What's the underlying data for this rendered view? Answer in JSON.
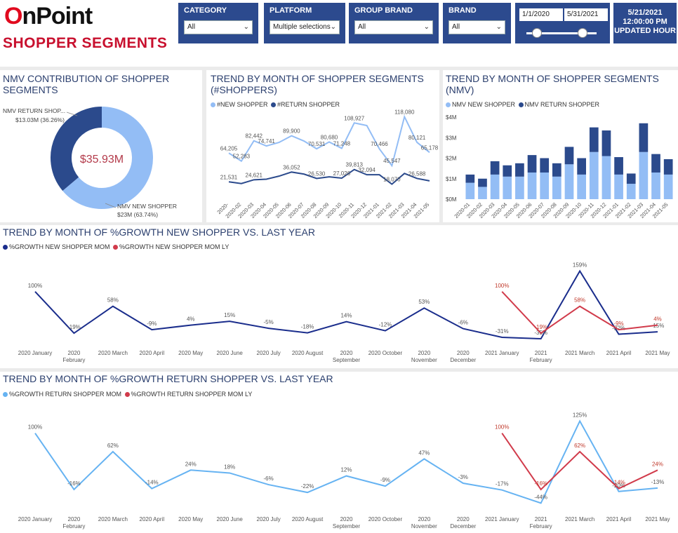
{
  "header": {
    "logo_mark": "O",
    "logo_rest": "nPoint",
    "title": "SHOPPER SEGMENTS"
  },
  "filters": [
    {
      "label": "CATEGORY",
      "value": "All"
    },
    {
      "label": "PLATFORM",
      "value": "Multiple selections"
    },
    {
      "label": "GROUP BRAND",
      "value": "All"
    },
    {
      "label": "BRAND",
      "value": "All"
    }
  ],
  "date_range": {
    "start": "1/1/2020",
    "end": "5/31/2021",
    "slider_start": 0.15,
    "slider_end": 0.8
  },
  "updated": {
    "date": "5/21/2021",
    "time": "12:00:00 PM",
    "label": "UPDATED HOUR"
  },
  "colors": {
    "dark_blue": "#2b4a8c",
    "light_blue": "#93bdf5",
    "navy": "#1a2d8c",
    "sky": "#66b3f2",
    "red": "#d13b4b",
    "title": "#2b3f6e"
  },
  "months_short": [
    "2020-01",
    "2020-02",
    "2020-03",
    "2020-04",
    "2020-05",
    "2020-06",
    "2020-07",
    "2020-08",
    "2020-09",
    "2020-10",
    "2020-11",
    "2020-12",
    "2021-01",
    "2021-02",
    "2021-03",
    "2021-04",
    "2021-05"
  ],
  "months_long": [
    "2020 January",
    "2020 February",
    "2020 March",
    "2020 April",
    "2020 May",
    "2020 June",
    "2020 July",
    "2020 August",
    "2020 September",
    "2020 October",
    "2020 November",
    "2020 December",
    "2021 January",
    "2021 February",
    "2021 March",
    "2021 April",
    "2021 May"
  ],
  "chart_data": [
    {
      "type": "pie",
      "title": "NMV CONTRIBUTION OF SHOPPER SEGMENTS",
      "center_label": "$35.93M",
      "slices": [
        {
          "name": "NMV RETURN SHOP...",
          "label": "$13.03M (36.26%)",
          "value": 13.03,
          "pct": 36.26
        },
        {
          "name": "NMV NEW SHOPPER",
          "label": "$23M (63.74%)",
          "value": 23,
          "pct": 63.74
        }
      ]
    },
    {
      "type": "line",
      "title": "TREND BY MONTH OF SHOPPER SEGMENTS (#SHOPPERS)",
      "x": [
        "2020-",
        "2020-02",
        "2020-03",
        "2020-04",
        "2020-05",
        "2020-06",
        "2020-07",
        "2020-08",
        "2020-09",
        "2020-10",
        "2020-11",
        "2020-12",
        "2021-01",
        "2021-02",
        "2021-03",
        "2021-04",
        "2021-05"
      ],
      "series": [
        {
          "name": "#NEW SHOPPER",
          "values": [
            64205,
            52283,
            82442,
            74741,
            80000,
            89900,
            82000,
            70531,
            80680,
            71248,
            108927,
            105000,
            70466,
            45547,
            118080,
            80121,
            65178
          ],
          "labels": [
            "64,205",
            "52,283",
            "82,442",
            "74,741",
            "",
            "89,900",
            "",
            "70,531",
            "80,680",
            "71,248",
            "108,927",
            "",
            "70,466",
            "45,547",
            "118,080",
            "80,121",
            "65,178"
          ]
        },
        {
          "name": "#RETURN SHOPPER",
          "values": [
            21531,
            19000,
            24621,
            25500,
            30000,
            36052,
            33000,
            26530,
            29000,
            27026,
            39813,
            32094,
            32094,
            18070,
            34000,
            26588,
            23000
          ],
          "labels": [
            "21,531",
            "",
            "24,621",
            "",
            "",
            "36,052",
            "",
            "26,530",
            "",
            "27,026",
            "39,813",
            "32,094",
            "",
            "18,070",
            "",
            "26,588",
            ""
          ]
        }
      ],
      "ylim": [
        0,
        130000
      ]
    },
    {
      "type": "bar",
      "title": "TREND BY MONTH OF SHOPPER SEGMENTS (NMV)",
      "categories": [
        "2020-01",
        "2020-02",
        "2020-03",
        "2020-04",
        "2020-05",
        "2020-06",
        "2020-07",
        "2020-08",
        "2020-09",
        "2020-10",
        "2020-11",
        "2020-12",
        "2021-01",
        "2021-02",
        "2021-03",
        "2021-04",
        "2021-05"
      ],
      "y_ticks": [
        "$0M",
        "$1M",
        "$2M",
        "$3M",
        "$4M"
      ],
      "series": [
        {
          "name": "NMV NEW SHOPPER",
          "values": [
            0.8,
            0.6,
            1.2,
            1.1,
            1.1,
            1.3,
            1.3,
            1.1,
            1.7,
            1.2,
            2.3,
            2.1,
            1.2,
            0.75,
            2.3,
            1.3,
            1.2
          ]
        },
        {
          "name": "NMV RETURN SHOPPER",
          "values": [
            0.4,
            0.4,
            0.65,
            0.55,
            0.65,
            0.85,
            0.7,
            0.65,
            0.85,
            0.8,
            1.2,
            1.25,
            0.85,
            0.5,
            1.4,
            0.9,
            0.75
          ]
        }
      ],
      "ylim": [
        0,
        4
      ]
    },
    {
      "type": "line",
      "title": "TREND BY MONTH OF %GROWTH NEW SHOPPER VS. LAST YEAR",
      "series": [
        {
          "name": "%GROWTH NEW SHOPPER MOM",
          "values": [
            100,
            -19,
            58,
            -9,
            4,
            15,
            -5,
            -18,
            14,
            -12,
            53,
            -6,
            -31,
            -35,
            159,
            -22,
            -15
          ],
          "labels": [
            "100%",
            "-19%",
            "58%",
            "-9%",
            "4%",
            "15%",
            "-5%",
            "-18%",
            "14%",
            "-12%",
            "53%",
            "-6%",
            "-31%",
            "-35%",
            "159%",
            "-22%",
            "-15%"
          ]
        },
        {
          "name": "%GROWTH NEW SHOPPER MOM LY",
          "values": [
            null,
            null,
            null,
            null,
            null,
            null,
            null,
            null,
            null,
            null,
            null,
            null,
            100,
            -19,
            58,
            -9,
            4
          ],
          "labels": [
            "",
            "",
            "",
            "",
            "",
            "",
            "",
            "",
            "",
            "",
            "",
            "",
            "100%",
            "-19%",
            "58%",
            "-9%",
            "4%"
          ]
        }
      ],
      "ylim": [
        -45,
        170
      ]
    },
    {
      "type": "line",
      "title": "TREND BY MONTH OF %GROWTH RETURN SHOPPER VS. LAST YEAR",
      "series": [
        {
          "name": "%GROWTH RETURN SHOPPER MOM",
          "values": [
            100,
            -16,
            62,
            -14,
            24,
            18,
            -6,
            -22,
            12,
            -9,
            47,
            -3,
            -17,
            -44,
            125,
            -20,
            -13
          ],
          "labels": [
            "100%",
            "-16%",
            "62%",
            "-14%",
            "24%",
            "18%",
            "-6%",
            "-22%",
            "12%",
            "-9%",
            "47%",
            "-3%",
            "-17%",
            "-44%",
            "125%",
            "-20%",
            "-13%"
          ]
        },
        {
          "name": "%GROWTH RETURN SHOPPER MOM LY",
          "values": [
            null,
            null,
            null,
            null,
            null,
            null,
            null,
            null,
            null,
            null,
            null,
            null,
            100,
            -16,
            62,
            -14,
            24
          ],
          "labels": [
            "",
            "",
            "",
            "",
            "",
            "",
            "",
            "",
            "",
            "",
            "",
            "",
            "100%",
            "-16%",
            "62%",
            "-14%",
            "24%"
          ]
        }
      ],
      "ylim": [
        -55,
        140
      ]
    }
  ]
}
